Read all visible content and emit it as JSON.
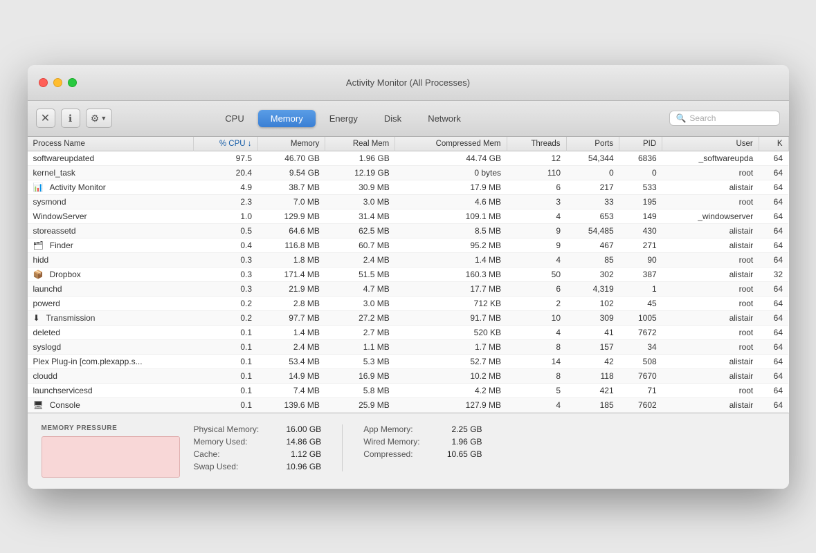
{
  "window": {
    "title": "Activity Monitor (All Processes)"
  },
  "toolbar": {
    "close_btn": "×",
    "info_btn": "ℹ",
    "gear_btn": "⚙",
    "tabs": [
      {
        "id": "cpu",
        "label": "CPU",
        "active": false
      },
      {
        "id": "memory",
        "label": "Memory",
        "active": true
      },
      {
        "id": "energy",
        "label": "Energy",
        "active": false
      },
      {
        "id": "disk",
        "label": "Disk",
        "active": false
      },
      {
        "id": "network",
        "label": "Network",
        "active": false
      }
    ],
    "search_placeholder": "Search"
  },
  "table": {
    "columns": [
      {
        "id": "name",
        "label": "Process Name",
        "sorted": false
      },
      {
        "id": "cpu",
        "label": "% CPU ↓",
        "sorted": true
      },
      {
        "id": "memory",
        "label": "Memory",
        "sorted": false
      },
      {
        "id": "realmem",
        "label": "Real Mem",
        "sorted": false
      },
      {
        "id": "compressed",
        "label": "Compressed Mem",
        "sorted": false
      },
      {
        "id": "threads",
        "label": "Threads",
        "sorted": false
      },
      {
        "id": "ports",
        "label": "Ports",
        "sorted": false
      },
      {
        "id": "pid",
        "label": "PID",
        "sorted": false
      },
      {
        "id": "user",
        "label": "User",
        "sorted": false
      },
      {
        "id": "k",
        "label": "K",
        "sorted": false
      }
    ],
    "rows": [
      {
        "name": "softwareupdated",
        "cpu": "97.5",
        "memory": "46.70 GB",
        "realmem": "1.96 GB",
        "compressed": "44.74 GB",
        "threads": "12",
        "ports": "54,344",
        "pid": "6836",
        "user": "_softwareupda",
        "k": "64",
        "icon": null
      },
      {
        "name": "kernel_task",
        "cpu": "20.4",
        "memory": "9.54 GB",
        "realmem": "12.19 GB",
        "compressed": "0 bytes",
        "threads": "110",
        "ports": "0",
        "pid": "0",
        "user": "root",
        "k": "64",
        "icon": null
      },
      {
        "name": "Activity Monitor",
        "cpu": "4.9",
        "memory": "38.7 MB",
        "realmem": "30.9 MB",
        "compressed": "17.9 MB",
        "threads": "6",
        "ports": "217",
        "pid": "533",
        "user": "alistair",
        "k": "64",
        "icon": "activity"
      },
      {
        "name": "sysmond",
        "cpu": "2.3",
        "memory": "7.0 MB",
        "realmem": "3.0 MB",
        "compressed": "4.6 MB",
        "threads": "3",
        "ports": "33",
        "pid": "195",
        "user": "root",
        "k": "64",
        "icon": null
      },
      {
        "name": "WindowServer",
        "cpu": "1.0",
        "memory": "129.9 MB",
        "realmem": "31.4 MB",
        "compressed": "109.1 MB",
        "threads": "4",
        "ports": "653",
        "pid": "149",
        "user": "_windowserver",
        "k": "64",
        "icon": null
      },
      {
        "name": "storeassetd",
        "cpu": "0.5",
        "memory": "64.6 MB",
        "realmem": "62.5 MB",
        "compressed": "8.5 MB",
        "threads": "9",
        "ports": "54,485",
        "pid": "430",
        "user": "alistair",
        "k": "64",
        "icon": null
      },
      {
        "name": "Finder",
        "cpu": "0.4",
        "memory": "116.8 MB",
        "realmem": "60.7 MB",
        "compressed": "95.2 MB",
        "threads": "9",
        "ports": "467",
        "pid": "271",
        "user": "alistair",
        "k": "64",
        "icon": "finder"
      },
      {
        "name": "hidd",
        "cpu": "0.3",
        "memory": "1.8 MB",
        "realmem": "2.4 MB",
        "compressed": "1.4 MB",
        "threads": "4",
        "ports": "85",
        "pid": "90",
        "user": "root",
        "k": "64",
        "icon": null
      },
      {
        "name": "Dropbox",
        "cpu": "0.3",
        "memory": "171.4 MB",
        "realmem": "51.5 MB",
        "compressed": "160.3 MB",
        "threads": "50",
        "ports": "302",
        "pid": "387",
        "user": "alistair",
        "k": "32",
        "icon": "dropbox"
      },
      {
        "name": "launchd",
        "cpu": "0.3",
        "memory": "21.9 MB",
        "realmem": "4.7 MB",
        "compressed": "17.7 MB",
        "threads": "6",
        "ports": "4,319",
        "pid": "1",
        "user": "root",
        "k": "64",
        "icon": null
      },
      {
        "name": "powerd",
        "cpu": "0.2",
        "memory": "2.8 MB",
        "realmem": "3.0 MB",
        "compressed": "712 KB",
        "threads": "2",
        "ports": "102",
        "pid": "45",
        "user": "root",
        "k": "64",
        "icon": null
      },
      {
        "name": "Transmission",
        "cpu": "0.2",
        "memory": "97.7 MB",
        "realmem": "27.2 MB",
        "compressed": "91.7 MB",
        "threads": "10",
        "ports": "309",
        "pid": "1005",
        "user": "alistair",
        "k": "64",
        "icon": "transmission"
      },
      {
        "name": "deleted",
        "cpu": "0.1",
        "memory": "1.4 MB",
        "realmem": "2.7 MB",
        "compressed": "520 KB",
        "threads": "4",
        "ports": "41",
        "pid": "7672",
        "user": "root",
        "k": "64",
        "icon": null
      },
      {
        "name": "syslogd",
        "cpu": "0.1",
        "memory": "2.4 MB",
        "realmem": "1.1 MB",
        "compressed": "1.7 MB",
        "threads": "8",
        "ports": "157",
        "pid": "34",
        "user": "root",
        "k": "64",
        "icon": null
      },
      {
        "name": "Plex Plug-in [com.plexapp.s...",
        "cpu": "0.1",
        "memory": "53.4 MB",
        "realmem": "5.3 MB",
        "compressed": "52.7 MB",
        "threads": "14",
        "ports": "42",
        "pid": "508",
        "user": "alistair",
        "k": "64",
        "icon": null
      },
      {
        "name": "cloudd",
        "cpu": "0.1",
        "memory": "14.9 MB",
        "realmem": "16.9 MB",
        "compressed": "10.2 MB",
        "threads": "8",
        "ports": "118",
        "pid": "7670",
        "user": "alistair",
        "k": "64",
        "icon": null
      },
      {
        "name": "launchservicesd",
        "cpu": "0.1",
        "memory": "7.4 MB",
        "realmem": "5.8 MB",
        "compressed": "4.2 MB",
        "threads": "5",
        "ports": "421",
        "pid": "71",
        "user": "root",
        "k": "64",
        "icon": null
      },
      {
        "name": "Console",
        "cpu": "0.1",
        "memory": "139.6 MB",
        "realmem": "25.9 MB",
        "compressed": "127.9 MB",
        "threads": "4",
        "ports": "185",
        "pid": "7602",
        "user": "alistair",
        "k": "64",
        "icon": "console"
      }
    ]
  },
  "bottom": {
    "memory_pressure_label": "MEMORY PRESSURE",
    "stats_left": [
      {
        "label": "Physical Memory:",
        "value": "16.00 GB"
      },
      {
        "label": "Memory Used:",
        "value": "14.86 GB"
      },
      {
        "label": "Cache:",
        "value": "1.12 GB"
      },
      {
        "label": "Swap Used:",
        "value": "10.96 GB"
      }
    ],
    "stats_right": [
      {
        "label": "App Memory:",
        "value": "2.25 GB"
      },
      {
        "label": "Wired Memory:",
        "value": "1.96 GB"
      },
      {
        "label": "Compressed:",
        "value": "10.65 GB"
      }
    ]
  }
}
